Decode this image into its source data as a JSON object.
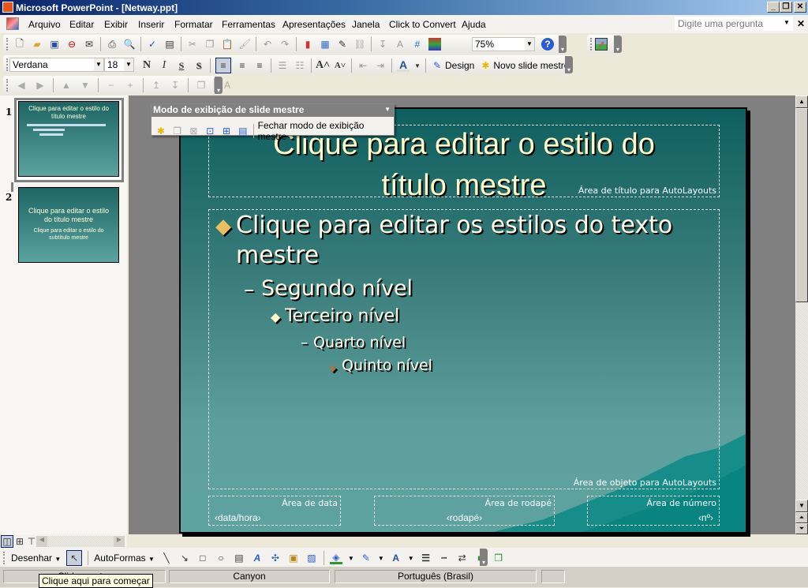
{
  "window": {
    "title": "Microsoft PowerPoint - [Netway.ppt]",
    "minimize": "_",
    "restore": "❐",
    "close": "✕"
  },
  "menu": {
    "items": [
      "Arquivo",
      "Editar",
      "Exibir",
      "Inserir",
      "Formatar",
      "Ferramentas",
      "Apresentações",
      "Janela",
      "Click to Convert",
      "Ajuda"
    ],
    "ask_placeholder": "Digite uma pergunta",
    "close": "✕"
  },
  "standard_toolbar": {
    "icons": [
      "new-icon",
      "open-icon",
      "save-icon",
      "permission-icon",
      "email-icon",
      "print-icon",
      "print-preview-icon",
      "spelling-icon",
      "research-icon",
      "cut-icon",
      "copy-icon",
      "paste-icon",
      "format-painter-icon",
      "undo-icon",
      "redo-icon",
      "chart-icon",
      "table-icon",
      "tables-borders-icon",
      "hyperlink-icon",
      "expand-icon",
      "show-formatting-icon",
      "grid-icon",
      "color-grayscale-icon"
    ],
    "zoom": "75%",
    "help": "?"
  },
  "formatting_toolbar": {
    "font": "Verdana",
    "size": "18",
    "bold": "N",
    "italic": "I",
    "underline": "S",
    "shadow": "S",
    "design_label": "Design",
    "new_master_label": "Novo slide mestre"
  },
  "master_toolbar": {
    "title": "Modo de exibição de slide mestre",
    "close_label": "Fechar modo de exibição mestre"
  },
  "thumbnails": [
    {
      "number": "1",
      "title": "Clique para editar o estilo do título mestre"
    },
    {
      "number": "2",
      "title": "Clique para editar o estilo do título mestre",
      "subtitle": "Clique para editar o estilo do subtítulo mestre"
    }
  ],
  "slide": {
    "title": "Clique para editar o estilo do título mestre",
    "title_line1": "Clique para editar o estilo do",
    "title_line2": "título mestre",
    "title_area_label": "Área de título para AutoLayouts",
    "levels": [
      {
        "bullet": "◆",
        "text": "Clique para editar os estilos do texto",
        "text2": "mestre",
        "bullet_color": "#e8c060"
      },
      {
        "bullet": "–",
        "text": "Segundo nível"
      },
      {
        "bullet": "◆",
        "text": "Terceiro nível",
        "bullet_color": "#ffffc8"
      },
      {
        "bullet": "–",
        "text": "Quarto nível"
      },
      {
        "bullet": "◆",
        "text": "Quinto nível",
        "bullet_color": "#a07850"
      }
    ],
    "object_area_label": "Área de objeto para AutoLayouts",
    "date_area_label": "Área de data",
    "date_value": "‹data/hora›",
    "footer_area_label": "Área de rodapé",
    "footer_value": "‹rodapé›",
    "number_area_label": "Área de número",
    "number_value": "‹nº›"
  },
  "drawing_toolbar": {
    "draw_label": "Desenhar",
    "autoshapes_label": "AutoFormas"
  },
  "status": {
    "slide": "Slide mestre",
    "design": "Canyon",
    "language": "Português (Brasil)"
  },
  "tooltip": "Clique aqui para começar"
}
